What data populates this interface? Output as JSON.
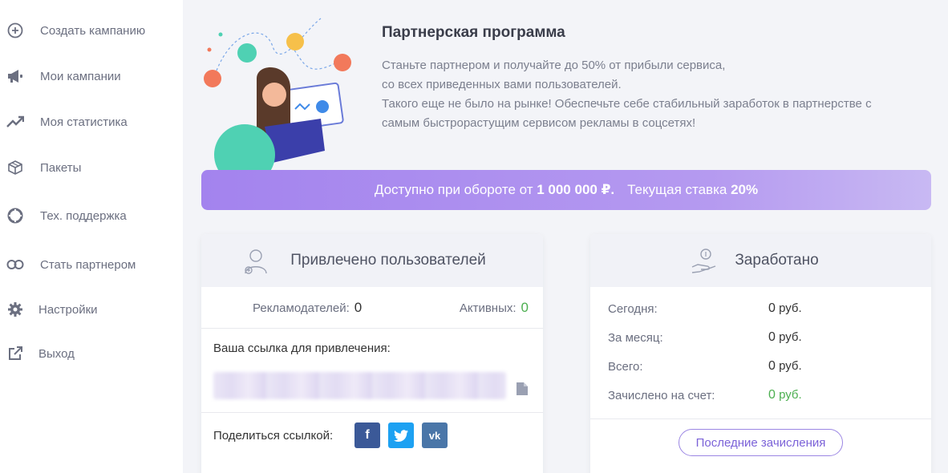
{
  "sidebar": {
    "items": [
      {
        "label": "Создать кампанию",
        "icon": "plus-circle-icon"
      },
      {
        "label": "Мои кампании",
        "icon": "megaphone-icon"
      },
      {
        "label": "Моя статистика",
        "icon": "trend-up-icon"
      },
      {
        "label": "Пакеты",
        "icon": "box-icon"
      },
      {
        "label": "Тех. поддержка",
        "icon": "lifebuoy-icon"
      },
      {
        "label": "Стать партнером",
        "icon": "link-icon"
      },
      {
        "label": "Настройки",
        "icon": "gear-icon"
      },
      {
        "label": "Выход",
        "icon": "external-link-icon"
      }
    ]
  },
  "hero": {
    "title": "Партнерская программа",
    "lines": [
      "Станьте партнером и получайте до 50% от прибыли сервиса,",
      "со всех приведенных вами пользователей.",
      "Такого еще не было на рынке! Обеспечьте себе стабильный заработок в партнерстве с",
      "самым быстрорастущим сервисом рекламы в соцсетях!"
    ]
  },
  "banner": {
    "prefix": "Доступно при обороте от",
    "turnover": "1 000 000 ₽.",
    "rate_label": "Текущая ставка",
    "rate": "20%"
  },
  "referrals": {
    "title": "Привлечено пользователей",
    "advertisers_label": "Рекламодателей:",
    "advertisers_value": "0",
    "active_label": "Активных:",
    "active_value": "0",
    "link_label": "Ваша ссылка для привлечения:",
    "share_label": "Поделиться ссылкой:",
    "social": {
      "facebook": "f",
      "twitter": "t",
      "vk": "vk"
    }
  },
  "earned": {
    "title": "Заработано",
    "rows": [
      {
        "label": "Сегодня:",
        "value": "0",
        "unit": "руб."
      },
      {
        "label": "За месяц:",
        "value": "0",
        "unit": "руб."
      },
      {
        "label": "Всего:",
        "value": "0",
        "unit": "руб."
      },
      {
        "label": "Зачислено на счет:",
        "value": "0",
        "unit": "руб."
      }
    ],
    "button": "Последние зачисления"
  },
  "colors": {
    "accent": "#a383ee",
    "green": "#4caf50",
    "facebook": "#3b5998",
    "twitter": "#1da1f2",
    "vk": "#4a76a8"
  }
}
